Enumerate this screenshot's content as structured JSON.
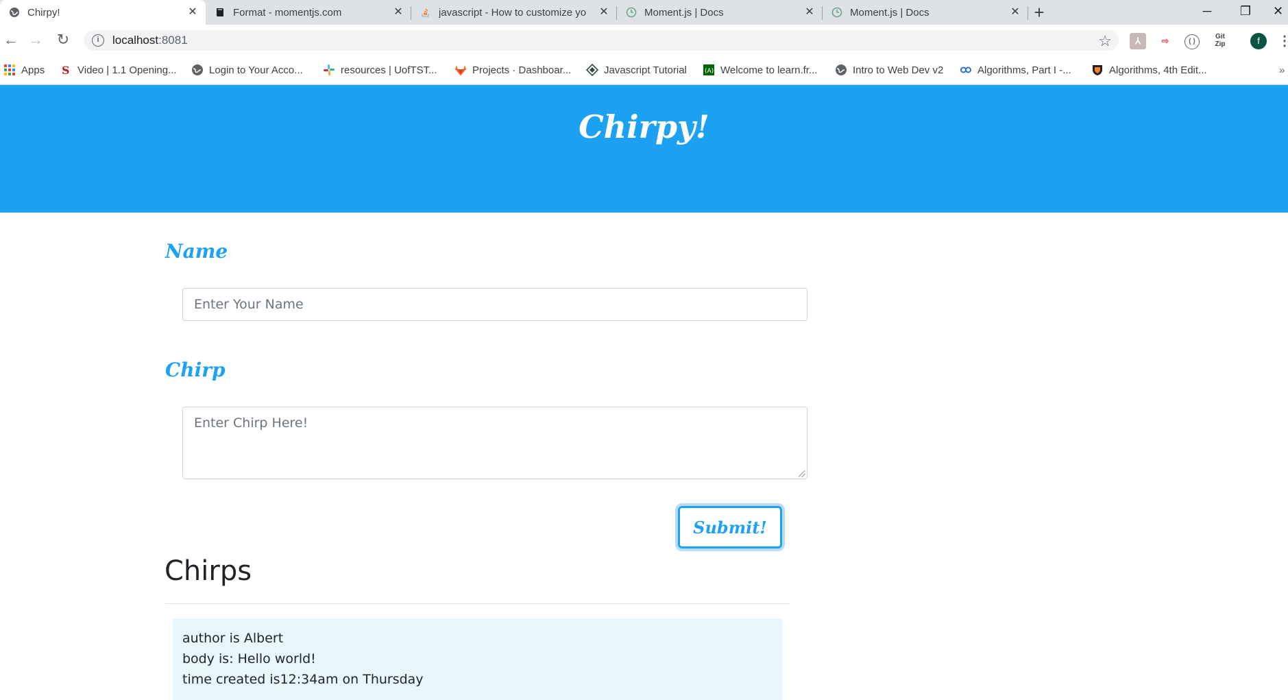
{
  "browser": {
    "tabs": [
      {
        "title": "Chirpy!",
        "icon": "globe-icon",
        "active": true
      },
      {
        "title": "Format - momentjs.com",
        "icon": "book-icon",
        "active": false
      },
      {
        "title": "javascript - How to customize yo",
        "icon": "stackoverflow-icon",
        "active": false
      },
      {
        "title": "Moment.js | Docs",
        "icon": "clock-icon",
        "active": false
      },
      {
        "title": "Moment.js | Docs",
        "icon": "clock-icon",
        "active": false
      }
    ],
    "url_host": "localhost",
    "url_port": ":8081",
    "profile_initial": "f",
    "bookmarks": [
      {
        "label": "Apps",
        "icon": "apps-grid-icon"
      },
      {
        "label": "Video | 1.1 Opening...",
        "icon": "s-logo-icon"
      },
      {
        "label": "Login to Your Acco...",
        "icon": "globe-icon"
      },
      {
        "label": "resources | UofTST...",
        "icon": "slack-icon"
      },
      {
        "label": "Projects · Dashboar...",
        "icon": "gitlab-icon"
      },
      {
        "label": "Javascript Tutorial",
        "icon": "diamond-icon"
      },
      {
        "label": "Welcome to learn.fr...",
        "icon": "fcc-icon"
      },
      {
        "label": "Intro to Web Dev v2",
        "icon": "globe-icon"
      },
      {
        "label": "Algorithms, Part I -...",
        "icon": "coursera-icon"
      },
      {
        "label": "Algorithms, 4th Edit...",
        "icon": "princeton-shield-icon"
      }
    ],
    "colors": {
      "tab_bg": "#dee1e6",
      "omnibox_bg": "#f1f3f4"
    }
  },
  "page": {
    "title": "Chirpy!",
    "name_label": "Name",
    "name_placeholder": "Enter Your Name",
    "chirp_label": "Chirp",
    "chirp_placeholder": "Enter Chirp Here!",
    "submit_label": "Submit!",
    "chirps_heading": "Chirps",
    "chirps": [
      {
        "author_line": "author is Albert",
        "body_line": "body is: Hello world!",
        "time_line": "time created is12:34am on Thursday"
      }
    ],
    "colors": {
      "brand": "#1da1f2",
      "card_bg": "#e8f6fe"
    }
  }
}
